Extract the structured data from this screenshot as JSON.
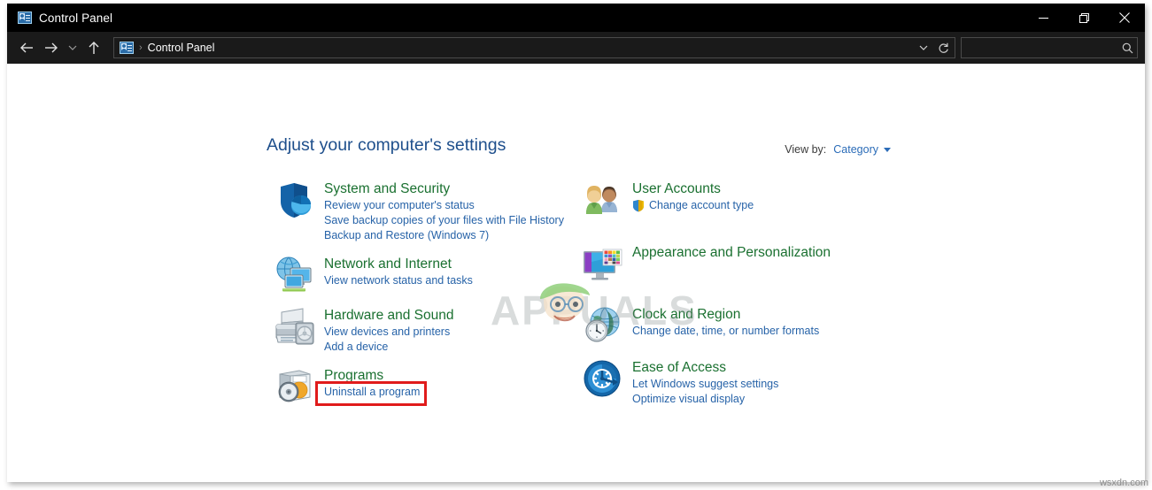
{
  "window": {
    "title": "Control Panel",
    "title_icon": "control-panel-icon",
    "buttons": {
      "minimize": "minimize-icon",
      "maximize": "restore-icon",
      "close": "close-icon"
    }
  },
  "navbar": {
    "back": "back-arrow-icon",
    "forward": "forward-arrow-icon",
    "recent": "chevron-down-icon",
    "up": "up-arrow-icon",
    "breadcrumb": {
      "icon": "control-panel-icon",
      "separator": "›",
      "path": "Control Panel"
    },
    "dropdown": "chevron-down-icon",
    "refresh": "refresh-icon",
    "search": {
      "value": "",
      "placeholder": "",
      "icon": "search-icon"
    }
  },
  "content": {
    "heading": "Adjust your computer's settings",
    "view_by": {
      "label": "View by:",
      "value": "Category",
      "caret": "caret-down-icon"
    },
    "left_column": [
      {
        "id": "system",
        "icon": "shield-security-icon",
        "title": "System and Security",
        "links": [
          "Review your computer's status",
          "Save backup copies of your files with File History",
          "Backup and Restore (Windows 7)"
        ]
      },
      {
        "id": "network",
        "icon": "network-globe-monitor-icon",
        "title": "Network and Internet",
        "links": [
          "View network status and tasks"
        ]
      },
      {
        "id": "hardware",
        "icon": "printer-icon",
        "title": "Hardware and Sound",
        "links": [
          "View devices and printers",
          "Add a device"
        ]
      },
      {
        "id": "programs",
        "icon": "programs-disc-icon",
        "title": "Programs",
        "links": [
          "Uninstall a program"
        ]
      }
    ],
    "right_column": [
      {
        "id": "useraccounts",
        "icon": "user-accounts-people-icon",
        "title": "User Accounts",
        "links": [
          "Change account type"
        ],
        "link_badge": "uac-shield-icon"
      },
      {
        "id": "appearance",
        "icon": "appearance-monitor-icon",
        "title": "Appearance and Personalization",
        "links": []
      },
      {
        "id": "clock",
        "icon": "clock-globe-icon",
        "title": "Clock and Region",
        "links": [
          "Change date, time, or number formats"
        ]
      },
      {
        "id": "ease",
        "icon": "ease-of-access-icon",
        "title": "Ease of Access",
        "links": [
          "Let Windows suggest settings",
          "Optimize visual display"
        ]
      }
    ],
    "annotation": {
      "target": "Uninstall a program",
      "color": "#e01b1b"
    },
    "watermark": "APPUALS",
    "corner_credit": "wsxdn.com"
  },
  "colors": {
    "titlebar_bg": "#000000",
    "navbar_bg": "#1a1a1a",
    "heading_blue": "#1e4f8c",
    "category_green": "#1a7030",
    "link_blue": "#2763a8",
    "annotation_red": "#e01b1b"
  }
}
